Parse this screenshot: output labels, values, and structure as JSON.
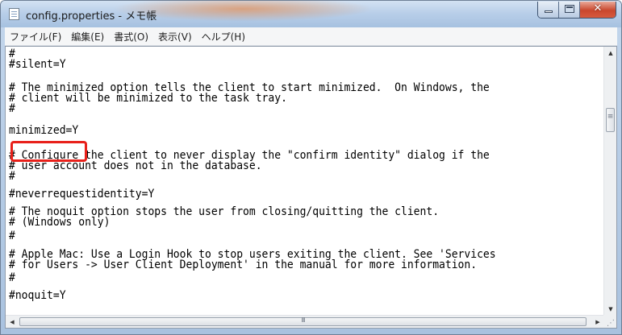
{
  "window": {
    "title": "config.properties - メモ帳"
  },
  "menu": {
    "items": [
      "ファイル(F)",
      "編集(E)",
      "書式(O)",
      "表示(V)",
      "ヘルプ(H)"
    ]
  },
  "editor": {
    "lines": [
      "#",
      "#silent=Y",
      "",
      "# The minimized option tells the client to start minimized.  On Windows, the",
      "# client will be minimized to the task tray.",
      "#",
      "minimized=Y",
      "",
      "# Configure the client to never display the \"confirm identity\" dialog if the",
      "# user account does not in the database.",
      "#",
      "#neverrequestidentity=Y",
      "",
      "# The noquit option stops the user from closing/quitting the client.",
      "# (Windows only)",
      "#",
      "# Apple Mac: Use a Login Hook to stop users exiting the client. See 'Services",
      "# for Users -> User Client Deployment' in the manual for more information.",
      "#",
      "#noquit=Y"
    ]
  },
  "colors": {
    "highlight": "#e8201a",
    "titlebar": "#b9cfe9",
    "close_button": "#c9472d"
  },
  "icons": {
    "app": "notepad-icon",
    "minimize": "minimize-icon",
    "maximize": "maximize-icon",
    "close": "close-icon"
  }
}
